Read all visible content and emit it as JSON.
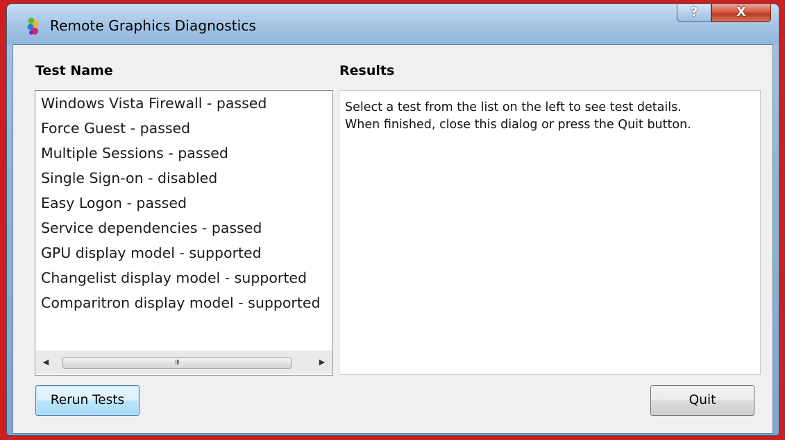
{
  "window": {
    "title": "Remote Graphics Diagnostics",
    "help_label": "?",
    "close_label": "X"
  },
  "columns": {
    "test_name_header": "Test Name",
    "results_header": "Results"
  },
  "tests": [
    {
      "label": "Windows Vista Firewall - passed"
    },
    {
      "label": "Force Guest - passed"
    },
    {
      "label": "Multiple Sessions - passed"
    },
    {
      "label": "Single Sign-on - disabled"
    },
    {
      "label": "Easy Logon - passed"
    },
    {
      "label": "Service dependencies - passed"
    },
    {
      "label": "GPU display model - supported"
    },
    {
      "label": "Changelist display model - supported"
    },
    {
      "label": "Comparitron display model - supported"
    }
  ],
  "scrollbar": {
    "left_arrow": "◀",
    "right_arrow": "▶",
    "grip": "III"
  },
  "results": {
    "line1": "Select a test from the list on the left to see test details.",
    "line2": "When finished, close this dialog or press the Quit button."
  },
  "buttons": {
    "rerun_label": "Rerun Tests",
    "quit_label": "Quit"
  }
}
